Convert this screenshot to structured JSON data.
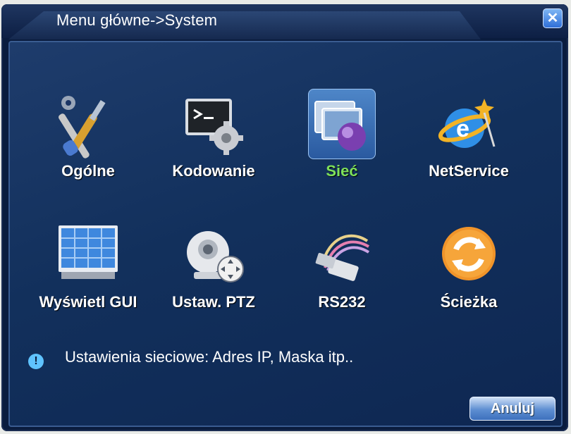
{
  "window": {
    "title": "Menu główne->System",
    "close_glyph": "✕"
  },
  "menu": {
    "items": [
      {
        "label": "Ogólne",
        "icon": "wrench-screwdriver-icon",
        "selected": false
      },
      {
        "label": "Kodowanie",
        "icon": "terminal-gear-icon",
        "selected": false
      },
      {
        "label": "Sieć",
        "icon": "network-monitors-icon",
        "selected": true
      },
      {
        "label": "NetService",
        "icon": "globe-service-icon",
        "selected": false
      },
      {
        "label": "Wyświetl GUI",
        "icon": "display-grid-icon",
        "selected": false
      },
      {
        "label": "Ustaw. PTZ",
        "icon": "ptz-camera-icon",
        "selected": false
      },
      {
        "label": "RS232",
        "icon": "rs232-cable-icon",
        "selected": false
      },
      {
        "label": "Ścieżka",
        "icon": "refresh-path-icon",
        "selected": false
      }
    ]
  },
  "status": {
    "info_glyph": "!",
    "text": "Ustawienia sieciowe: Adres IP, Maska itp.."
  },
  "buttons": {
    "cancel": "Anuluj"
  },
  "colors": {
    "background": "#0a1c3e",
    "panel": "#12305c",
    "selected_label": "#7ee05a",
    "accent": "#5fc3ff"
  }
}
